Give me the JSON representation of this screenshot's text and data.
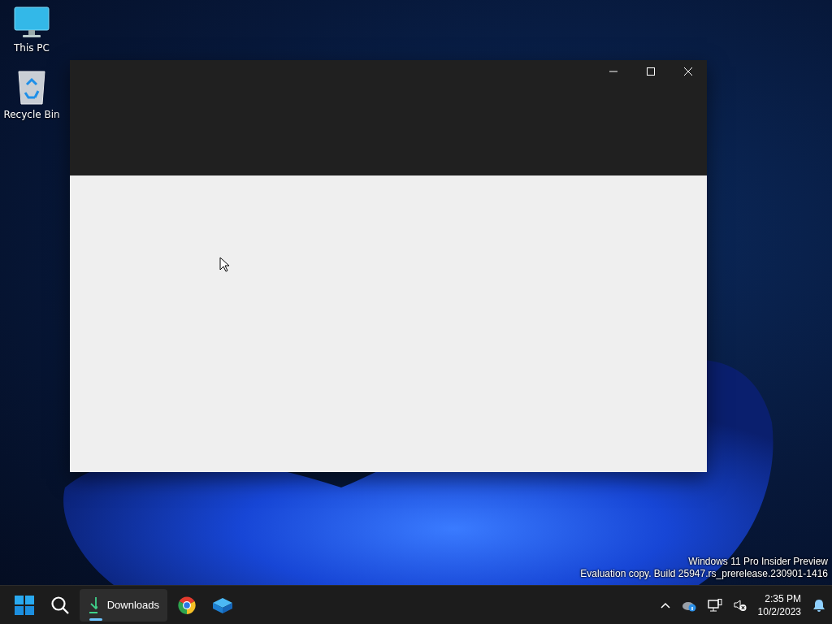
{
  "desktop_icons": [
    {
      "kind": "computer",
      "label": "This PC"
    },
    {
      "kind": "recycle-bin",
      "label": "Recycle Bin"
    }
  ],
  "system_notice": [
    "Windows 11 Pro Insider Preview",
    "Evaluation copy. Build 25947.rs_prerelease.230901-1416"
  ],
  "taskbar": {
    "apps": [
      {
        "kind": "downloads",
        "label": "Downloads",
        "selected": true
      },
      {
        "kind": "browser",
        "selected": false
      },
      {
        "kind": "box",
        "selected": false
      }
    ],
    "clock": {
      "time": "2:35 PM",
      "date": "10/2/2023"
    }
  }
}
